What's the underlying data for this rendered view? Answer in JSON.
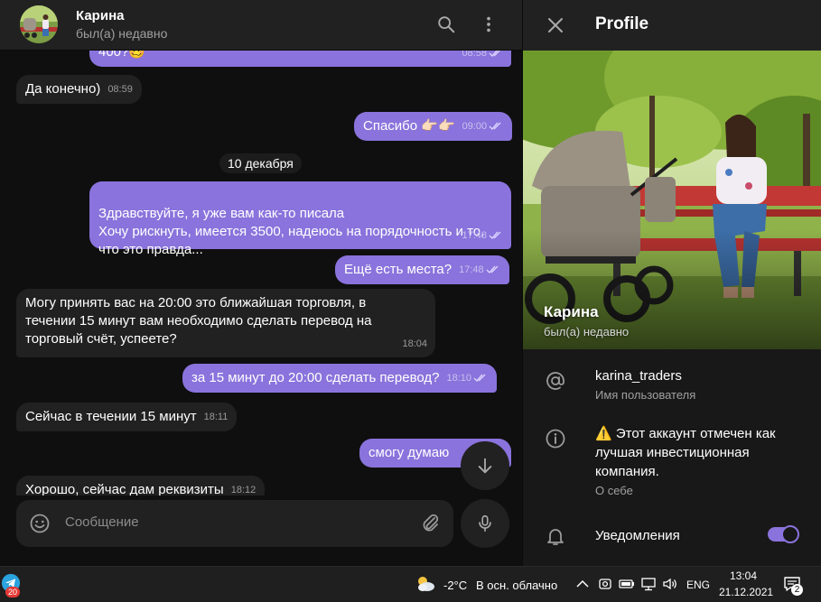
{
  "chat": {
    "contact_name": "Карина",
    "contact_status": "был(а) недавно",
    "date_separator": "10 декабря",
    "composer_placeholder": "Сообщение",
    "messages": [
      {
        "text": "400?🥴",
        "time": "08:58",
        "direction": "out"
      },
      {
        "text": "Да конечно)",
        "time": "08:59",
        "direction": "in"
      },
      {
        "text": "Спасибо 👉🏻👉🏻",
        "time": "09:00",
        "direction": "out"
      },
      {
        "text": "Здравствуйте, я уже вам как-то писала\nХочу рискнуть, имеется 3500, надеюсь на порядочность и то, что это правда...",
        "time": "17:48",
        "direction": "out"
      },
      {
        "text": "Ещё есть места?",
        "time": "17:48",
        "direction": "out"
      },
      {
        "text": "Могу принять вас на 20:00 это ближайшая торговля, в течении 15 минут вам необходимо сделать перевод на торговый счёт, успеете?",
        "time": "18:04",
        "direction": "in"
      },
      {
        "text": "за 15 минут до 20:00 сделать перевод?",
        "time": "18:10",
        "direction": "out"
      },
      {
        "text": "Сейчас в течении 15 минут",
        "time": "18:11",
        "direction": "in"
      },
      {
        "text": "смогу думаю",
        "time": "",
        "direction": "out"
      },
      {
        "text": "Хорошо, сейчас дам реквизиты",
        "time": "18:12",
        "direction": "in"
      }
    ]
  },
  "profile": {
    "title": "Profile",
    "name": "Карина",
    "status": "был(а) недавно",
    "username": "karina_traders",
    "username_label": "Имя пользователя",
    "bio": "⚠️ Этот аккаунт отмечен как лучшая инвестиционная компания.",
    "bio_label": "О себе",
    "notifications_label": "Уведомления",
    "notifications_on": true
  },
  "taskbar": {
    "telegram_badge": "20",
    "temperature": "-2°C",
    "weather": "В осн. облачно",
    "language": "ENG",
    "time": "13:04",
    "date": "21.12.2021",
    "notification_count": "2"
  },
  "colors": {
    "accent": "#8a73dc",
    "bubble_in": "#212121",
    "background": "#0f0f0f",
    "telegram_blue": "#2aa3df",
    "badge_red": "#e53935"
  }
}
